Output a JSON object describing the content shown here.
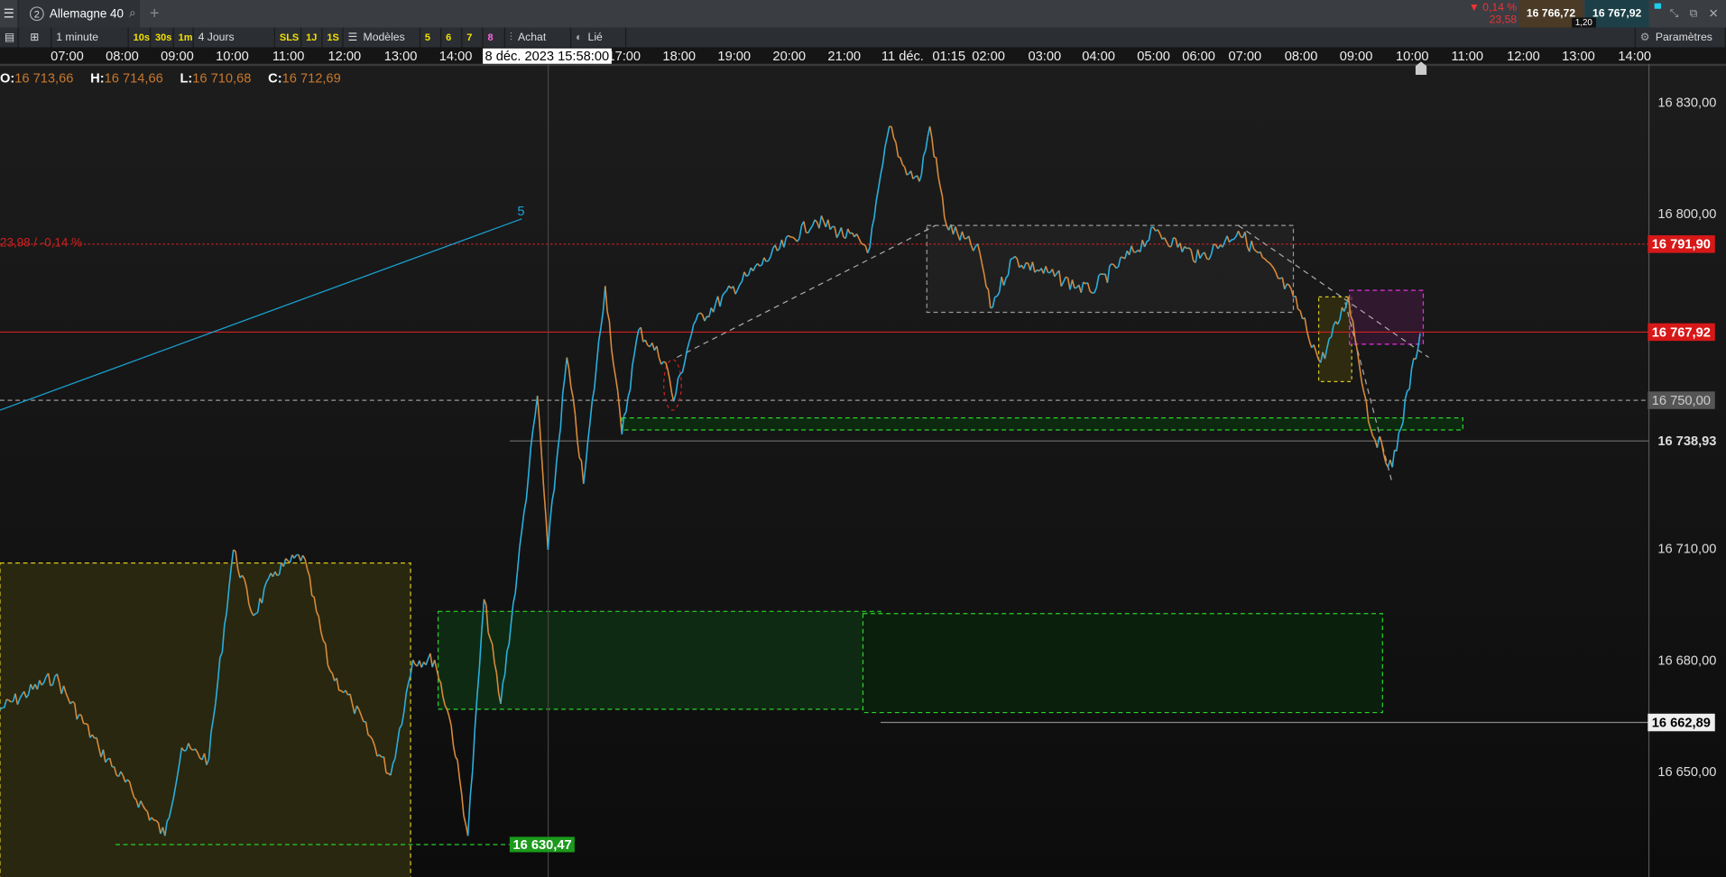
{
  "tabbar": {
    "menu_icon": "hamburger-icon",
    "tab_number": "2",
    "tab_label": "Allemagne 40",
    "add": "+",
    "change_pct": "▼ 0,14 %",
    "change_abs": "23,58",
    "bid": "16 766,72",
    "ask": "16 767,92",
    "spread": "1,20"
  },
  "toolbar": {
    "interval": "1 minute",
    "quick": [
      "10s",
      "30s",
      "1m"
    ],
    "range": "4 Jours",
    "quick2": [
      "SLS",
      "1J",
      "1S"
    ],
    "models": "Modèles",
    "nums": [
      "5",
      "6",
      "7",
      "8"
    ],
    "buy": "Achat",
    "linked": "Lié",
    "settings": "Paramètres"
  },
  "time_axis": {
    "ticks": [
      "07:00",
      "08:00",
      "09:00",
      "10:00",
      "11:00",
      "12:00",
      "13:00",
      "14:00",
      "17:00",
      "18:00",
      "19:00",
      "20:00",
      "21:00",
      "11 déc.",
      "01:15",
      "02:00",
      "03:00",
      "04:00",
      "05:00",
      "06:00",
      "07:00",
      "08:00",
      "09:00",
      "10:00",
      "11:00",
      "12:00",
      "13:00",
      "14:00"
    ],
    "cursor_label": "8 déc. 2023 15:58:00"
  },
  "ohlc": {
    "o_label": "O:",
    "o": "16 713,66",
    "h_label": "H:",
    "h": "16 714,66",
    "l_label": "L:",
    "l": "16 710,68",
    "c_label": "C:",
    "c": "16 712,69"
  },
  "chart_data": {
    "type": "line",
    "title": "Allemagne 40 — 1 minute",
    "ylim": [
      16620,
      16845
    ],
    "price_ticks": [
      16830,
      16800,
      16710,
      16680,
      16650
    ],
    "price_tick_labels": [
      "16 830,00",
      "16 800,00",
      "16 710,00",
      "16 680,00",
      "16 650,00"
    ],
    "x_units": "chart hours from 07:00 (8 déc.)",
    "x": [
      -1.21,
      -0.22,
      0.57,
      1.76,
      2.06,
      2.55,
      2.99,
      3.35,
      3.74,
      4.24,
      4.73,
      5.13,
      5.82,
      6.22,
      6.61,
      6.91,
      7.21,
      7.5,
      7.8,
      8.1,
      8.46,
      8.65,
      8.99,
      9.29,
      9.68,
      9.98,
      10.28,
      10.77,
      10.91,
      11.27,
      12.26,
      13.45,
      14.44,
      14.79,
      15.03,
      15.33,
      15.52,
      15.82,
      16.42,
      16.61,
      17.01,
      18.4,
      19.58,
      20.38,
      21.07,
      22.06,
      22.55,
      23.05,
      23.45,
      23.84,
      24.34
    ],
    "y": [
      16666.8,
      16675.7,
      16656.5,
      16632.8,
      16656.5,
      16653.5,
      16709.7,
      16692,
      16703.8,
      16708.2,
      16677.2,
      16668.3,
      16649.1,
      16680.1,
      16680.1,
      16662.4,
      16632.8,
      16696.4,
      16668.3,
      16703.8,
      16751.1,
      16709.7,
      16761.4,
      16727.4,
      16780.6,
      16740.7,
      16768.8,
      16760,
      16749.6,
      16770.3,
      16783.6,
      16798.4,
      16791,
      16823.5,
      16813.2,
      16808.7,
      16823.5,
      16796.9,
      16789.5,
      16774.7,
      16788,
      16779.2,
      16795.4,
      16788,
      16795.4,
      16777.7,
      16760,
      16777.7,
      16742.2,
      16731.9,
      16767.9
    ],
    "levels": {
      "prev_close_label": "23,98 / -0,14 %",
      "prev_close": "16 791,90",
      "last": "16 767,92",
      "level1": "16 750,00",
      "level2": "16 738,93",
      "level3": "16 662,89",
      "low_marker": "16 630,47"
    },
    "annotations": {
      "wave_label": "5"
    }
  }
}
